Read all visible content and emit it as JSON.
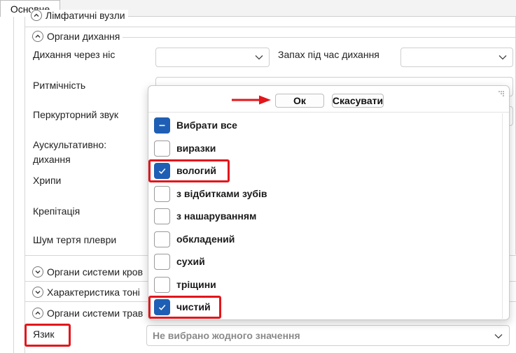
{
  "tabs": [
    {
      "label": "Основне"
    }
  ],
  "groups": {
    "lymph_partial": "Лімфатичні вузли",
    "respiratory": "Органи дихання",
    "blood": "Органи системи кров",
    "tonic": "Характеристика тоні",
    "digestive": "Органи системи трав"
  },
  "fields": {
    "nasal_breathing": "Дихання через ніс",
    "breath_smell": "Запах під час дихання",
    "rhythm": "Ритмічність",
    "percussion": "Перкурторний звук",
    "auscultation_line1": "Аускультативно:",
    "auscultation_line2": "дихання",
    "wheezing": "Хрипи",
    "crepitation": "Крепітація",
    "pleural_rub": "Шум тертя плеври",
    "tongue": "Язик"
  },
  "popup": {
    "ok_label": "Ок",
    "cancel_label": "Скасувати",
    "items": [
      {
        "label": "Вибрати все",
        "state": "partial"
      },
      {
        "label": "виразки",
        "state": "off"
      },
      {
        "label": "вологий",
        "state": "on"
      },
      {
        "label": "з відбитками зубів",
        "state": "off"
      },
      {
        "label": "з нашаруванням",
        "state": "off"
      },
      {
        "label": "обкладений",
        "state": "off"
      },
      {
        "label": "сухий",
        "state": "off"
      },
      {
        "label": "тріщини",
        "state": "off"
      },
      {
        "label": "чистий",
        "state": "on"
      }
    ]
  },
  "tongue_combo": {
    "placeholder": "Не вибрано жодного значення"
  },
  "colors": {
    "accent": "#1e5fb5",
    "highlight": "#e2161b"
  }
}
